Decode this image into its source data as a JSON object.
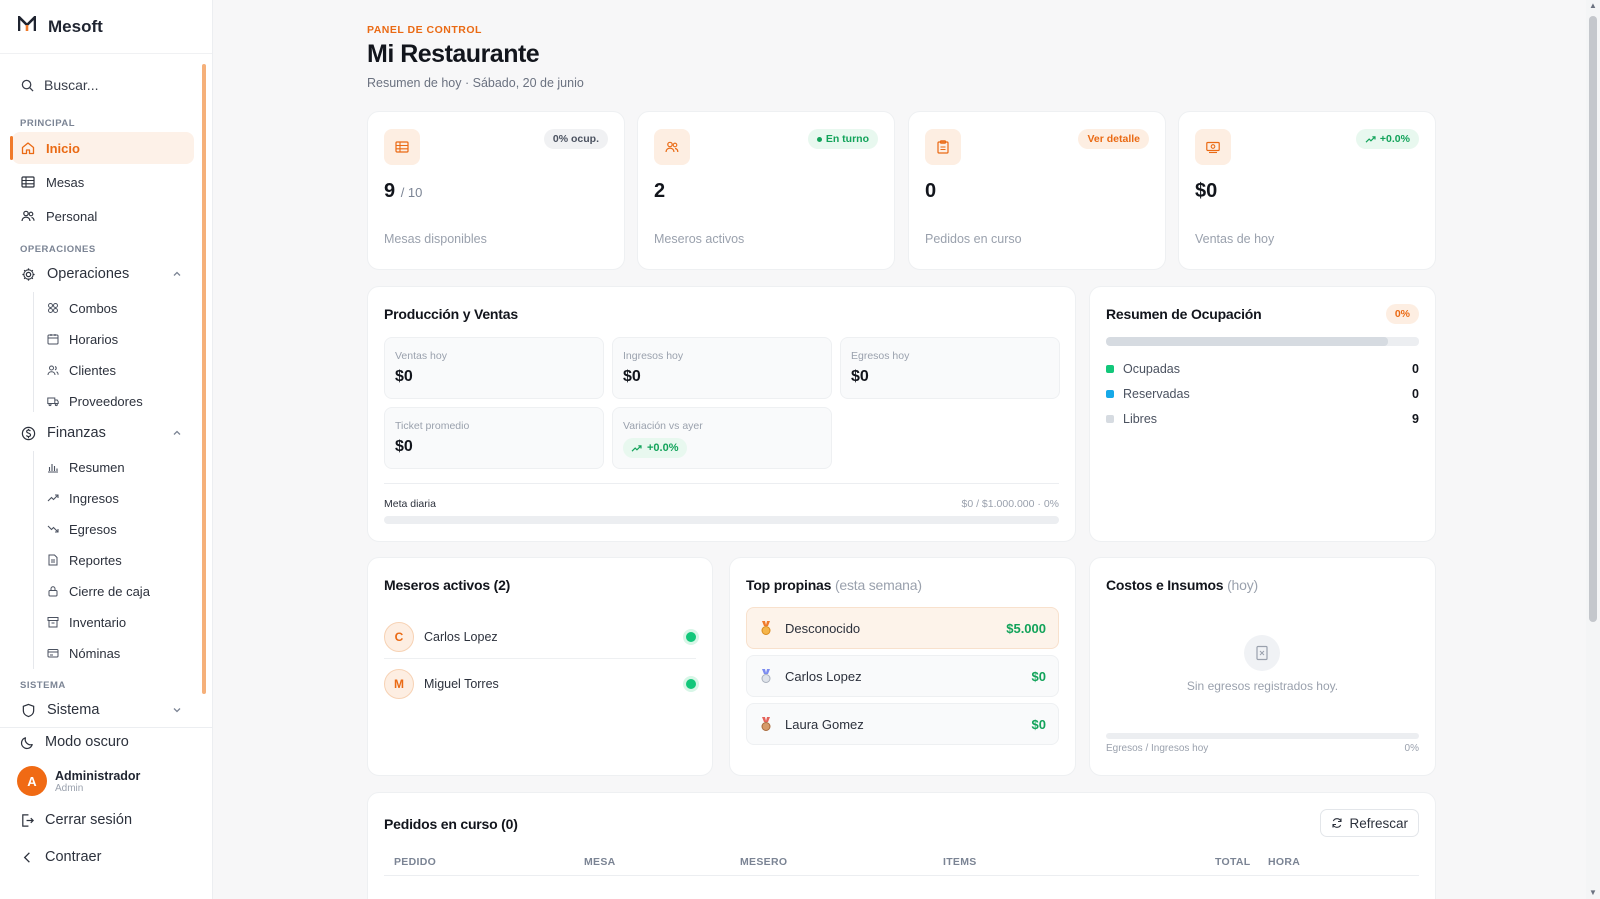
{
  "brand": {
    "logo": "M",
    "name": "Mesoft"
  },
  "search": {
    "placeholder": "Buscar..."
  },
  "sidebar": {
    "section_principal": "PRINCIPAL",
    "inicio": "Inicio",
    "mesas": "Mesas",
    "personal": "Personal",
    "section_operaciones": "OPERACIONES",
    "operaciones": "Operaciones",
    "operaciones_items": [
      "Combos",
      "Horarios",
      "Clientes",
      "Proveedores"
    ],
    "finanzas": "Finanzas",
    "finanzas_items": [
      "Resumen",
      "Ingresos",
      "Egresos",
      "Reportes",
      "Cierre de caja",
      "Inventario",
      "Nóminas"
    ],
    "section_sistema": "SISTEMA",
    "sistema": "Sistema"
  },
  "bottom": {
    "dark_mode": "Modo oscuro",
    "user_initial": "A",
    "user_name": "Administrador",
    "user_role": "Admin",
    "logout": "Cerrar sesión",
    "collapse": "Contraer"
  },
  "header": {
    "eyebrow": "PANEL DE CONTROL",
    "title": "Mi Restaurante",
    "subtitle": "Resumen de hoy · Sábado, 20 de junio"
  },
  "stats": [
    {
      "badge": "0% ocup.",
      "value": "9",
      "value_suffix": "/ 10",
      "label": "Mesas disponibles"
    },
    {
      "badge": "En turno",
      "value": "2",
      "label": "Meseros activos"
    },
    {
      "badge": "Ver detalle",
      "value": "0",
      "label": "Pedidos en curso"
    },
    {
      "badge": "+0.0%",
      "value": "$0",
      "label": "Ventas de hoy"
    }
  ],
  "produccion": {
    "title": "Producción y Ventas",
    "ventas_label": "Ventas hoy",
    "ventas_value": "$0",
    "ingresos_label": "Ingresos hoy",
    "ingresos_value": "$0",
    "egresos_label": "Egresos hoy",
    "egresos_value": "$0",
    "ticket_label": "Ticket promedio",
    "ticket_value": "$0",
    "variacion_label": "Variación vs ayer",
    "variacion_value": "+0.0%",
    "meta_label": "Meta diaria",
    "meta_value": "$0 / $1.000.000 · 0%",
    "meta_progress": 0
  },
  "ocupacion": {
    "title": "Resumen de Ocupación",
    "badge": "0%",
    "rows": [
      {
        "label": "Ocupadas",
        "value": "0",
        "color": "#12c77a"
      },
      {
        "label": "Reservadas",
        "value": "0",
        "color": "#16a9e8"
      },
      {
        "label": "Libres",
        "value": "9",
        "color": "#d6dbe1"
      }
    ]
  },
  "meseros": {
    "title": "Meseros activos (2)",
    "items": [
      {
        "initial": "C",
        "name": "Carlos Lopez"
      },
      {
        "initial": "M",
        "name": "Miguel Torres"
      }
    ]
  },
  "propinas": {
    "title": "Top propinas",
    "title_suffix": "(esta semana)",
    "items": [
      {
        "name": "Desconocido",
        "amount": "$5.000"
      },
      {
        "name": "Carlos Lopez",
        "amount": "$0"
      },
      {
        "name": "Laura Gomez",
        "amount": "$0"
      }
    ]
  },
  "costos": {
    "title": "Costos e Insumos",
    "title_suffix": "(hoy)",
    "empty": "Sin egresos registrados hoy.",
    "foot_label": "Egresos / Ingresos hoy",
    "foot_value": "0%"
  },
  "pedidos": {
    "title": "Pedidos en curso (0)",
    "refresh": "Refrescar",
    "columns": [
      "PEDIDO",
      "MESA",
      "MESERO",
      "ITEMS",
      "TOTAL",
      "HORA"
    ]
  },
  "colors": {
    "accent": "#f07a2a",
    "success": "#12a35a"
  }
}
